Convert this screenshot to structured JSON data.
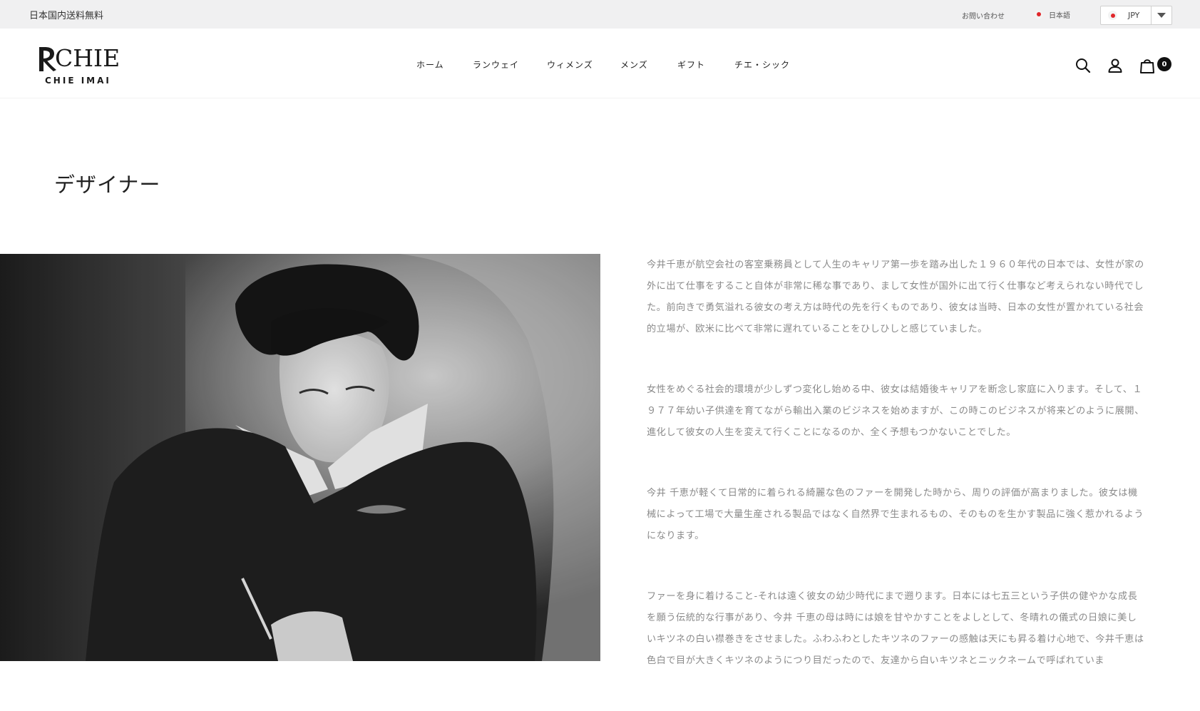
{
  "topbar": {
    "shipping_text": "日本国内送料無料",
    "contact_label": "お問い合わせ",
    "language_label": "日本語",
    "currency_code": "JPY"
  },
  "header": {
    "logo": {
      "brand": "CHIE",
      "sub": "CHIE IMAI"
    },
    "nav": [
      {
        "label": "ホーム"
      },
      {
        "label": "ランウェイ"
      },
      {
        "label": "ウィメンズ"
      },
      {
        "label": "メンズ"
      },
      {
        "label": "ギフト"
      },
      {
        "label": "チエ・シック"
      }
    ],
    "icons": {
      "search": "search-icon",
      "account": "user-icon",
      "cart": "shopping-bag-icon"
    },
    "cart_count": "0"
  },
  "page": {
    "title": "デザイナー",
    "paragraphs": [
      "今井千恵が航空会社の客室乗務員として人生のキャリア第一歩を踏み出した１９６０年代の日本では、女性が家の外に出て仕事をすること自体が非常に稀な事であり、まして女性が国外に出て行く仕事など考えられない時代でした。前向きで勇気溢れる彼女の考え方は時代の先を行くものであり、彼女は当時、日本の女性が置かれている社会的立場が、欧米に比べて非常に遅れていることをひしひしと感じていました。",
      "女性をめぐる社会的環境が少しずつ変化し始める中、彼女は結婚後キャリアを断念し家庭に入ります。そして、１９７７年幼い子供達を育てながら輸出入業のビジネスを始めますが、この時このビジネスが将来どのように展開、進化して彼女の人生を変えて行くことになるのか、全く予想もつかないことでした。",
      "今井 千恵が軽くて日常的に着られる綺麗な色のファーを開発した時から、周りの評価が高まりました。彼女は機械によって工場で大量生産される製品ではなく自然界で生まれるもの、そのものを生かす製品に強く惹かれるようになります。",
      "ファーを身に着けること-それは遠く彼女の幼少時代にまで遡ります。日本には七五三という子供の健やかな成長を願う伝統的な行事があり、今井 千恵の母は時には娘を甘やかすことをよしとして、冬晴れの儀式の日娘に美しいキツネの白い襟巻きをさせました。ふわふわとしたキツネのファーの感触は天にも昇る着け心地で、今井千恵は色白で目が大きくキツネのようにつり目だったので、友達から白いキツネとニックネームで呼ばれていま"
    ]
  }
}
